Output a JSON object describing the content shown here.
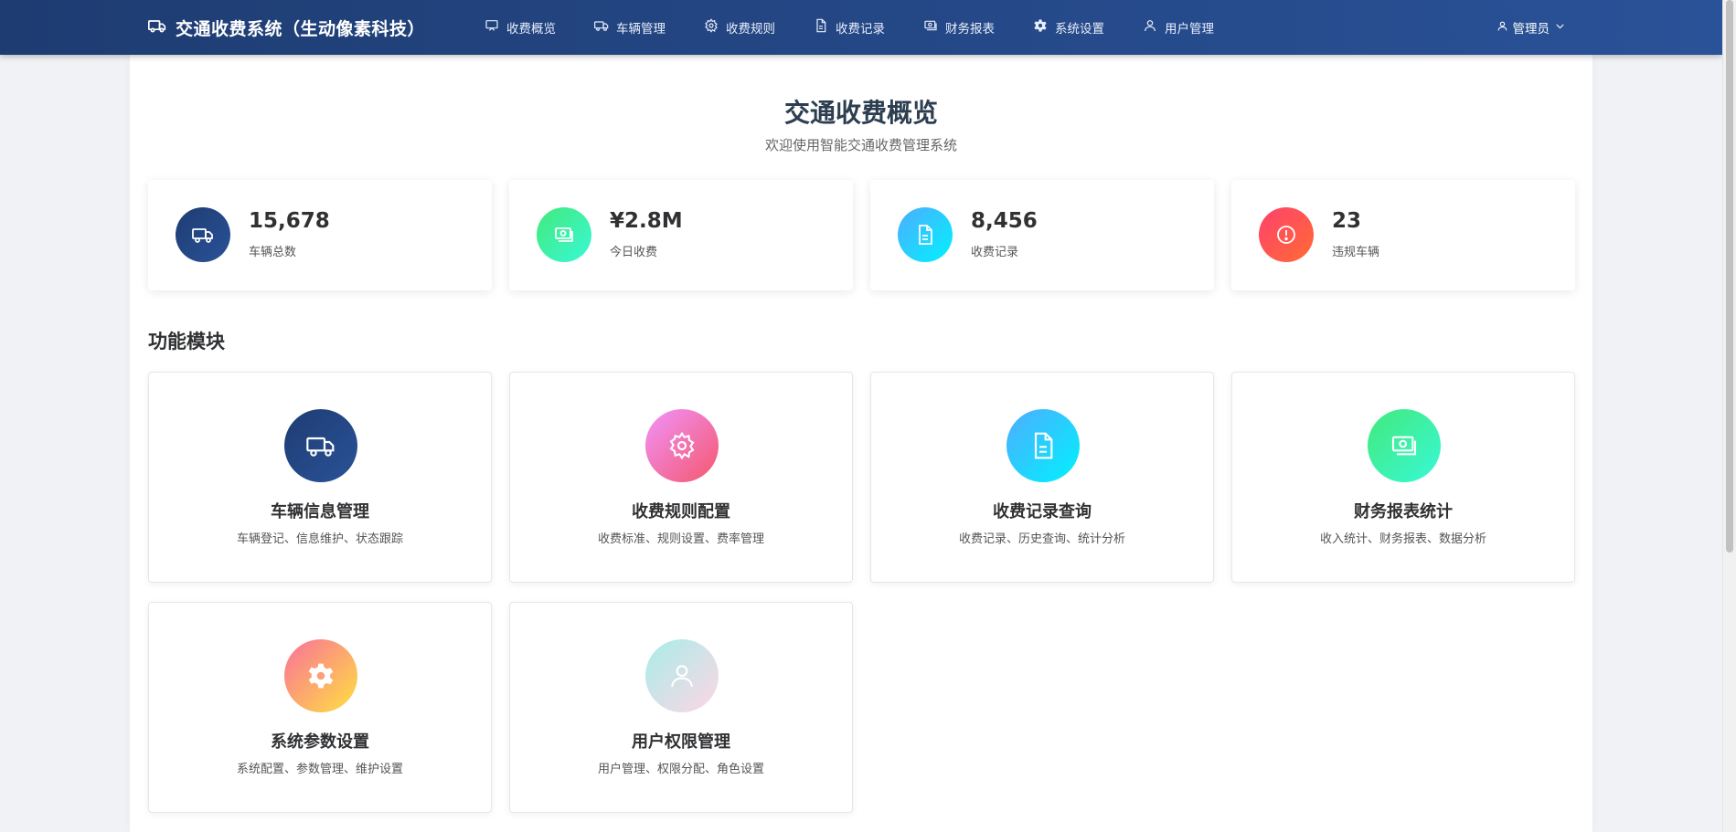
{
  "app": {
    "title": "交通收费系统（生动像素科技）"
  },
  "nav": {
    "items": [
      {
        "label": "收费概览",
        "icon": "monitor-icon"
      },
      {
        "label": "车辆管理",
        "icon": "truck-icon"
      },
      {
        "label": "收费规则",
        "icon": "gear-outline-icon"
      },
      {
        "label": "收费记录",
        "icon": "document-icon"
      },
      {
        "label": "财务报表",
        "icon": "money-icon"
      },
      {
        "label": "系统设置",
        "icon": "gear-filled-icon"
      },
      {
        "label": "用户管理",
        "icon": "user-icon"
      }
    ],
    "user_label": "管理员"
  },
  "page": {
    "title": "交通收费概览",
    "subtitle": "欢迎使用智能交通收费管理系统"
  },
  "stats": [
    {
      "value": "15,678",
      "label": "车辆总数",
      "icon": "truck-icon",
      "color": "#1e3c72"
    },
    {
      "value": "¥2.8M",
      "label": "今日收费",
      "icon": "money-icon",
      "color": "#43e97b"
    },
    {
      "value": "8,456",
      "label": "收费记录",
      "icon": "document-icon",
      "color": "#4facfe"
    },
    {
      "value": "23",
      "label": "违规车辆",
      "icon": "warning-icon",
      "color": "#ff416c"
    }
  ],
  "modules": {
    "section_title": "功能模块",
    "items": [
      {
        "title": "车辆信息管理",
        "desc": "车辆登记、信息维护、状态跟踪",
        "icon": "truck-icon"
      },
      {
        "title": "收费规则配置",
        "desc": "收费标准、规则设置、费率管理",
        "icon": "gear-outline-icon"
      },
      {
        "title": "收费记录查询",
        "desc": "收费记录、历史查询、统计分析",
        "icon": "document-icon"
      },
      {
        "title": "财务报表统计",
        "desc": "收入统计、财务报表、数据分析",
        "icon": "money-icon"
      },
      {
        "title": "系统参数设置",
        "desc": "系统配置、参数管理、维护设置",
        "icon": "gear-filled-icon"
      },
      {
        "title": "用户权限管理",
        "desc": "用户管理、权限分配、角色设置",
        "icon": "user-icon"
      }
    ]
  },
  "colors": {
    "nav_gradient_start": "#1e3c72",
    "nav_gradient_end": "#2a5298"
  }
}
